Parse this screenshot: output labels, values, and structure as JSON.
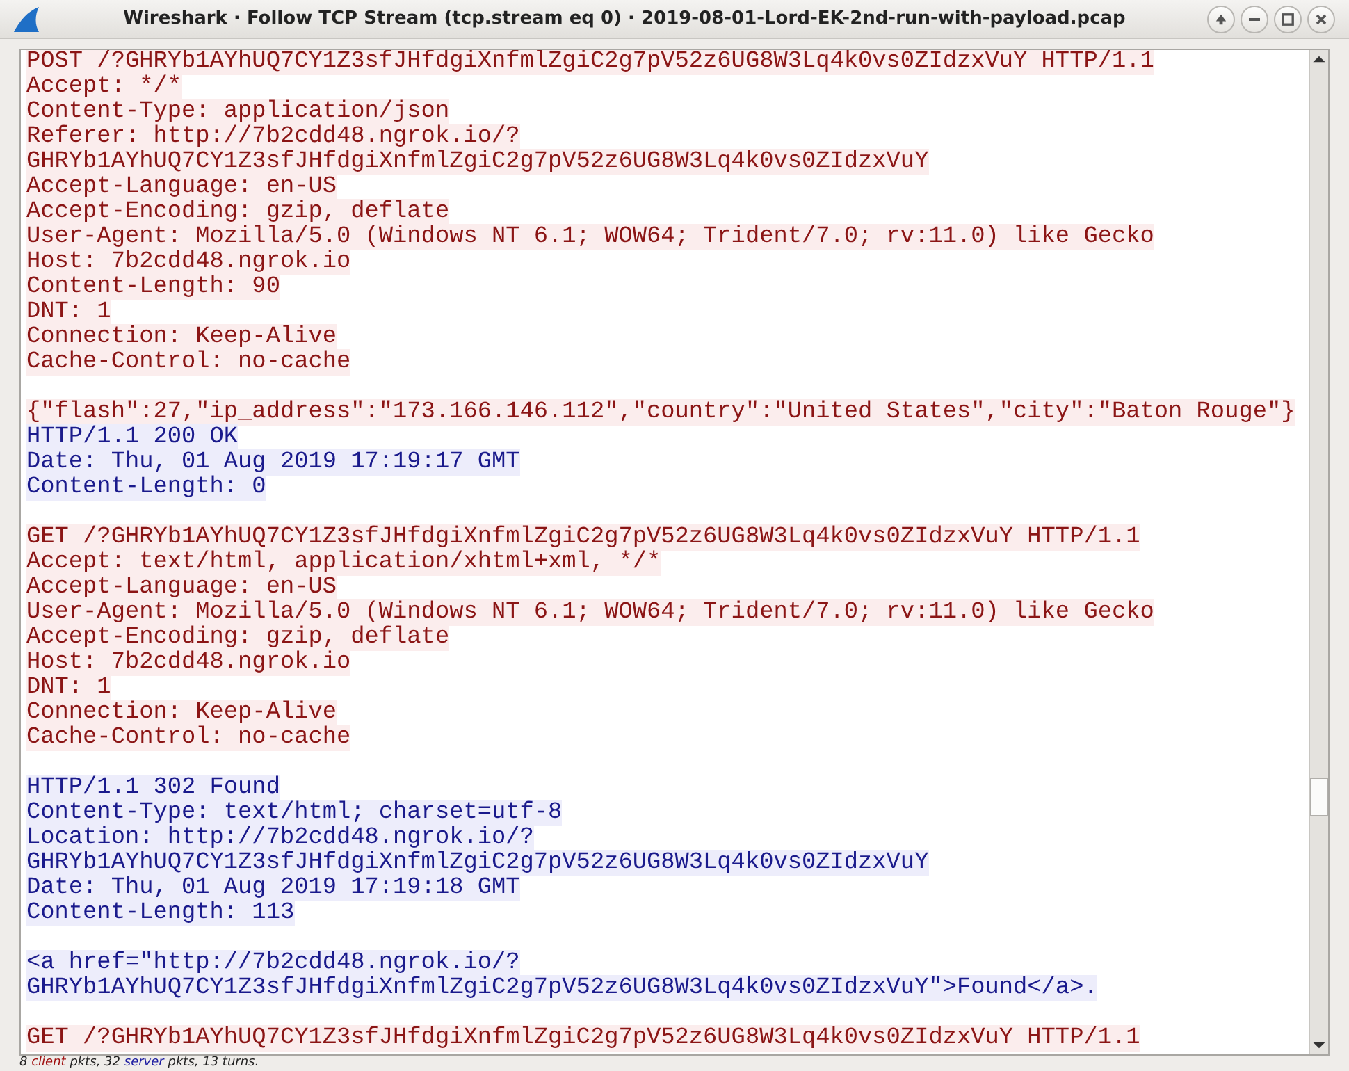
{
  "window": {
    "title": "Wireshark · Follow TCP Stream (tcp.stream eq 0) · 2019-08-01-Lord-EK-2nd-run-with-payload.pcap"
  },
  "stream": [
    {
      "kind": "client",
      "gap_before": false,
      "lines": [
        "POST /?GHRYb1AYhUQ7CY1Z3sfJHfdgiXnfmlZgiC2g7pV52z6UG8W3Lq4k0vs0ZIdzxVuY HTTP/1.1",
        "Accept: */*",
        "Content-Type: application/json",
        "Referer: http://7b2cdd48.ngrok.io/?",
        "GHRYb1AYhUQ7CY1Z3sfJHfdgiXnfmlZgiC2g7pV52z6UG8W3Lq4k0vs0ZIdzxVuY",
        "Accept-Language: en-US",
        "Accept-Encoding: gzip, deflate",
        "User-Agent: Mozilla/5.0 (Windows NT 6.1; WOW64; Trident/7.0; rv:11.0) like Gecko",
        "Host: 7b2cdd48.ngrok.io",
        "Content-Length: 90",
        "DNT: 1",
        "Connection: Keep-Alive",
        "Cache-Control: no-cache"
      ]
    },
    {
      "kind": "client",
      "gap_before": true,
      "lines": [
        "{\"flash\":27,\"ip_address\":\"173.166.146.112\",\"country\":\"United States\",\"city\":\"Baton Rouge\"}"
      ]
    },
    {
      "kind": "server",
      "gap_before": false,
      "lines": [
        "HTTP/1.1 200 OK",
        "Date: Thu, 01 Aug 2019 17:19:17 GMT",
        "Content-Length: 0"
      ]
    },
    {
      "kind": "client",
      "gap_before": true,
      "lines": [
        "GET /?GHRYb1AYhUQ7CY1Z3sfJHfdgiXnfmlZgiC2g7pV52z6UG8W3Lq4k0vs0ZIdzxVuY HTTP/1.1",
        "Accept: text/html, application/xhtml+xml, */*",
        "Accept-Language: en-US",
        "User-Agent: Mozilla/5.0 (Windows NT 6.1; WOW64; Trident/7.0; rv:11.0) like Gecko",
        "Accept-Encoding: gzip, deflate",
        "Host: 7b2cdd48.ngrok.io",
        "DNT: 1",
        "Connection: Keep-Alive",
        "Cache-Control: no-cache"
      ]
    },
    {
      "kind": "server",
      "gap_before": true,
      "lines": [
        "HTTP/1.1 302 Found",
        "Content-Type: text/html; charset=utf-8",
        "Location: http://7b2cdd48.ngrok.io/?",
        "GHRYb1AYhUQ7CY1Z3sfJHfdgiXnfmlZgiC2g7pV52z6UG8W3Lq4k0vs0ZIdzxVuY",
        "Date: Thu, 01 Aug 2019 17:19:18 GMT",
        "Content-Length: 113"
      ]
    },
    {
      "kind": "server",
      "gap_before": true,
      "lines": [
        "<a href=\"http://7b2cdd48.ngrok.io/?",
        "GHRYb1AYhUQ7CY1Z3sfJHfdgiXnfmlZgiC2g7pV52z6UG8W3Lq4k0vs0ZIdzxVuY\">Found</a>."
      ]
    },
    {
      "kind": "client",
      "gap_before": true,
      "lines": [
        "GET /?GHRYb1AYhUQ7CY1Z3sfJHfdgiXnfmlZgiC2g7pV52z6UG8W3Lq4k0vs0ZIdzxVuY HTTP/1.1"
      ]
    }
  ],
  "status_bar": [
    {
      "kind": "plain",
      "text": "8 "
    },
    {
      "kind": "client",
      "text": "client"
    },
    {
      "kind": "plain",
      "text": " pkts, 32 "
    },
    {
      "kind": "server",
      "text": "server"
    },
    {
      "kind": "plain",
      "text": " pkts, 13 turns."
    }
  ]
}
